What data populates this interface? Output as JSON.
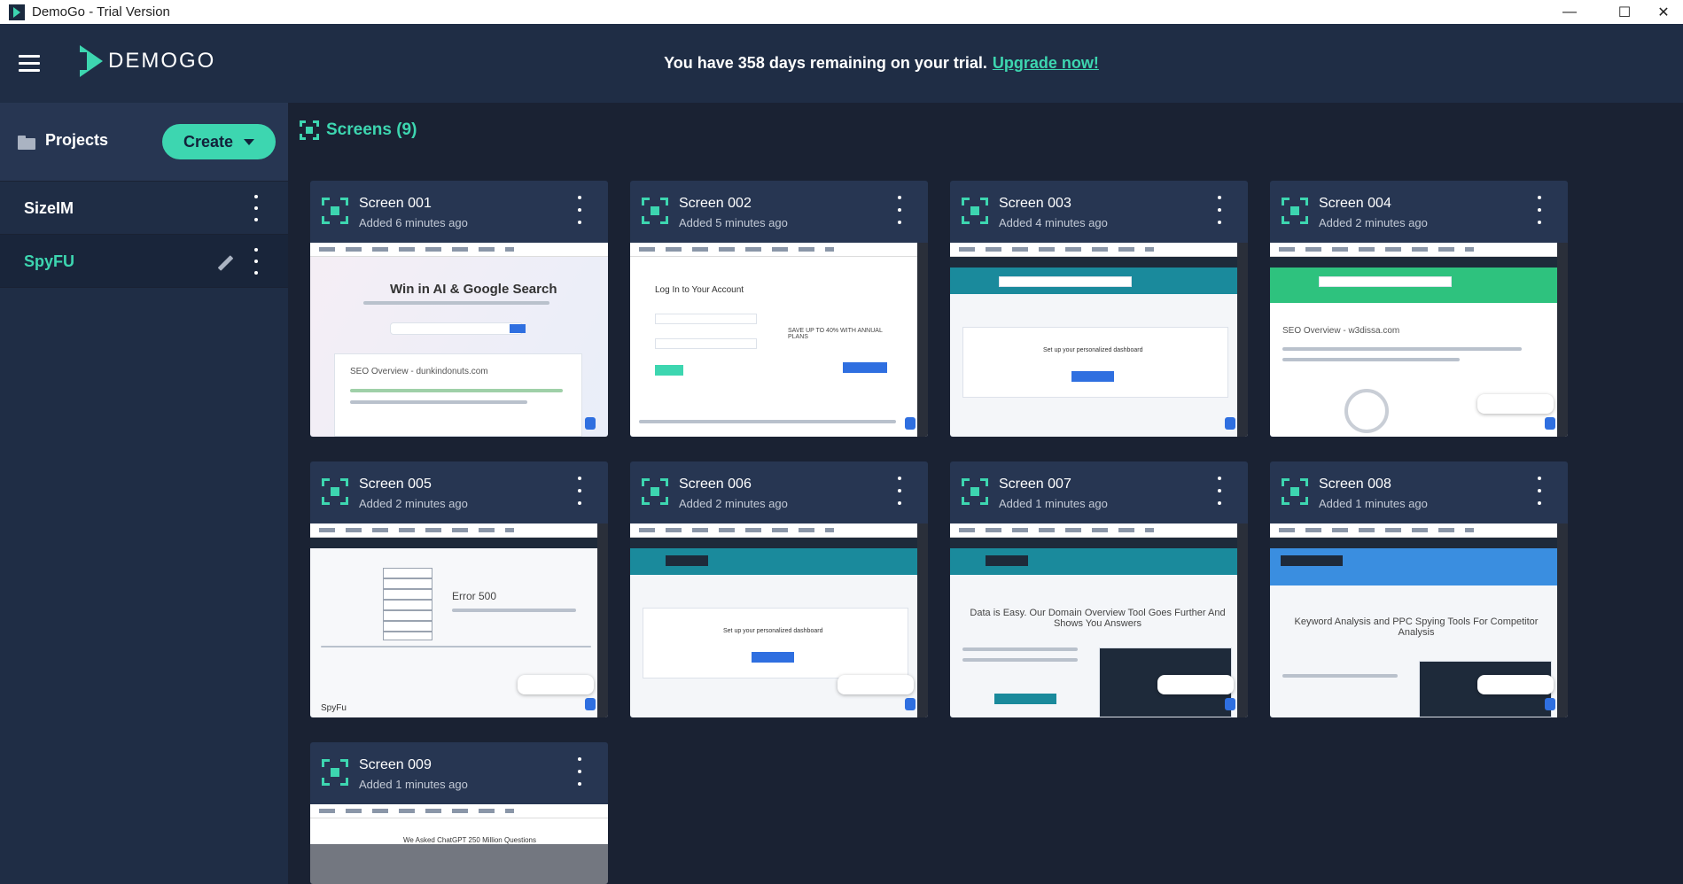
{
  "window": {
    "title": "DemoGo - Trial Version",
    "minimize_glyph": "—",
    "maximize_glyph": "☐",
    "close_glyph": "✕"
  },
  "header": {
    "logo_text": "DEMOGO",
    "trial_text": "You have 358 days remaining on your trial.",
    "upgrade_link": "Upgrade now!"
  },
  "sidebar": {
    "title": "Projects",
    "create_label": "Create",
    "projects": [
      {
        "name": "SizeIM",
        "active": false
      },
      {
        "name": "SpyFU",
        "active": true
      }
    ]
  },
  "main": {
    "heading": "Screens (9)",
    "screens": [
      {
        "name": "Screen 001",
        "added": "Added 6 minutes ago",
        "preview_text": "Win in AI & Google Search",
        "preview_sub": "SEO Overview - dunkindonuts.com"
      },
      {
        "name": "Screen 002",
        "added": "Added 5 minutes ago",
        "preview_text": "Log In to Your Account",
        "preview_sub": "SAVE UP TO 40% WITH ANNUAL PLANS"
      },
      {
        "name": "Screen 003",
        "added": "Added 4 minutes ago",
        "preview_text": "Set up your personalized dashboard",
        "preview_sub": ""
      },
      {
        "name": "Screen 004",
        "added": "Added 2 minutes ago",
        "preview_text": "SEO Overview - w3dissa.com",
        "preview_sub": ""
      },
      {
        "name": "Screen 005",
        "added": "Added 2 minutes ago",
        "preview_text": "Error 500",
        "preview_sub": "SpyFu"
      },
      {
        "name": "Screen 006",
        "added": "Added 2 minutes ago",
        "preview_text": "Set up your personalized dashboard",
        "preview_sub": ""
      },
      {
        "name": "Screen 007",
        "added": "Added 1 minutes ago",
        "preview_text": "Data is Easy. Our Domain Overview Tool Goes Further And Shows You Answers",
        "preview_sub": ""
      },
      {
        "name": "Screen 008",
        "added": "Added 1 minutes ago",
        "preview_text": "Keyword Analysis and PPC Spying Tools For Competitor Analysis",
        "preview_sub": ""
      },
      {
        "name": "Screen 009",
        "added": "Added 1 minutes ago",
        "preview_text": "We Asked ChatGPT 250 Million Questions",
        "preview_sub": ""
      }
    ]
  },
  "colors": {
    "accent": "#3dd6b0",
    "header_bg": "#1f2d45",
    "page_bg": "#1a2233",
    "card_bg": "#273652"
  },
  "icons": [
    "app-icon",
    "hamburger-icon",
    "logo-mark-icon",
    "folder-icon",
    "caret-down-icon",
    "kebab-icon",
    "pencil-icon",
    "frame-icon"
  ]
}
